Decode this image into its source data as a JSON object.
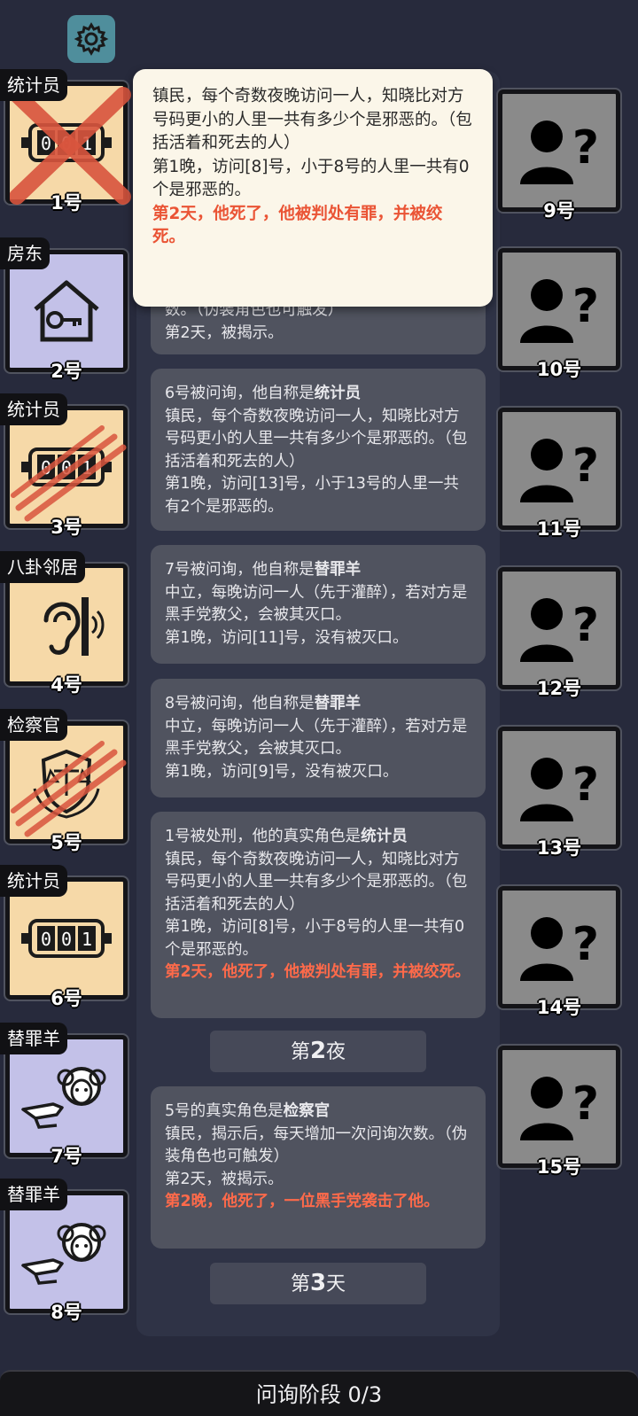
{
  "popup": {
    "lines": [
      "镇民，每个奇数夜晚访问一人，知晓比对方号码更小的人里一共有多少个是邪恶的。（包括活着和死去的人）",
      "第1晚，访问[8]号，小于8号的人里一共有0个是邪恶的。"
    ],
    "death": "第2天，他死了，他被判处有罪，并被绞死。"
  },
  "log": {
    "card0": {
      "lines": [
        "数。（伪装角色也可触发）",
        "第2天，被揭示。"
      ]
    },
    "card1": {
      "prefix": "6号被问询，他自称是",
      "role": "统计员",
      "lines": [
        "镇民，每个奇数夜晚访问一人，知晓比对方号码更小的人里一共有多少个是邪恶的。（包括活着和死去的人）",
        "第1晚，访问[13]号，小于13号的人里一共有2个是邪恶的。"
      ]
    },
    "card2": {
      "prefix": "7号被问询，他自称是",
      "role": "替罪羊",
      "lines": [
        "中立，每晚访问一人（先于灌醉），若对方是黑手党教父，会被其灭口。",
        "第1晚，访问[11]号，没有被灭口。"
      ]
    },
    "card3": {
      "prefix": "8号被问询，他自称是",
      "role": "替罪羊",
      "lines": [
        "中立，每晚访问一人（先于灌醉），若对方是黑手党教父，会被其灭口。",
        "第1晚，访问[9]号，没有被灭口。"
      ]
    },
    "card4": {
      "prefix": "1号被处刑，他的真实角色是",
      "role": "统计员",
      "lines": [
        "镇民，每个奇数夜晚访问一人，知晓比对方号码更小的人里一共有多少个是邪恶的。（包括活着和死去的人）",
        "第1晚，访问[8]号，小于8号的人里一共有0个是邪恶的。"
      ],
      "death": "第2天，他死了，他被判处有罪，并被绞死。"
    },
    "card5": {
      "prefix": "5号的真实角色是",
      "role": "检察官",
      "lines": [
        "镇民，揭示后，每天增加一次问询次数。（伪装角色也可触发）",
        "第2天，被揭示。"
      ],
      "death": "第2晚，他死了，一位黑手党袭击了他。"
    },
    "divider1": {
      "pre": "第",
      "num": "2",
      "post": "夜"
    },
    "divider2": {
      "pre": "第",
      "num": "3",
      "post": "天"
    }
  },
  "players": {
    "p1": {
      "role": "统计员",
      "num": "1号"
    },
    "p2": {
      "role": "房东",
      "num": "2号"
    },
    "p3": {
      "role": "统计员",
      "num": "3号"
    },
    "p4": {
      "role": "八卦邻居",
      "num": "4号"
    },
    "p5": {
      "role": "检察官",
      "num": "5号"
    },
    "p6": {
      "role": "统计员",
      "num": "6号"
    },
    "p7": {
      "role": "替罪羊",
      "num": "7号"
    },
    "p8": {
      "role": "替罪羊",
      "num": "8号"
    },
    "p9": {
      "num": "9号"
    },
    "p10": {
      "num": "10号"
    },
    "p11": {
      "num": "11号"
    },
    "p12": {
      "num": "12号"
    },
    "p13": {
      "num": "13号"
    },
    "p14": {
      "num": "14号"
    },
    "p15": {
      "num": "15号"
    }
  },
  "phase": "问询阶段 0/3",
  "icons": {
    "settings": "gear-icon",
    "statistician": "counter-icon",
    "landlord": "house-key-icon",
    "gossip": "ear-icon",
    "prosecutor": "scales-shield-icon",
    "scapegoat": "sheep-pointing-icon",
    "unknown": "unknown-person-icon"
  },
  "colors": {
    "background": "#272a3c",
    "death_text": "#ea5435",
    "tile_beige": "#f6d9a8",
    "tile_lavender": "#c3c1e8",
    "tile_unknown": "#8a8a8a",
    "slash": "#d9553e"
  }
}
